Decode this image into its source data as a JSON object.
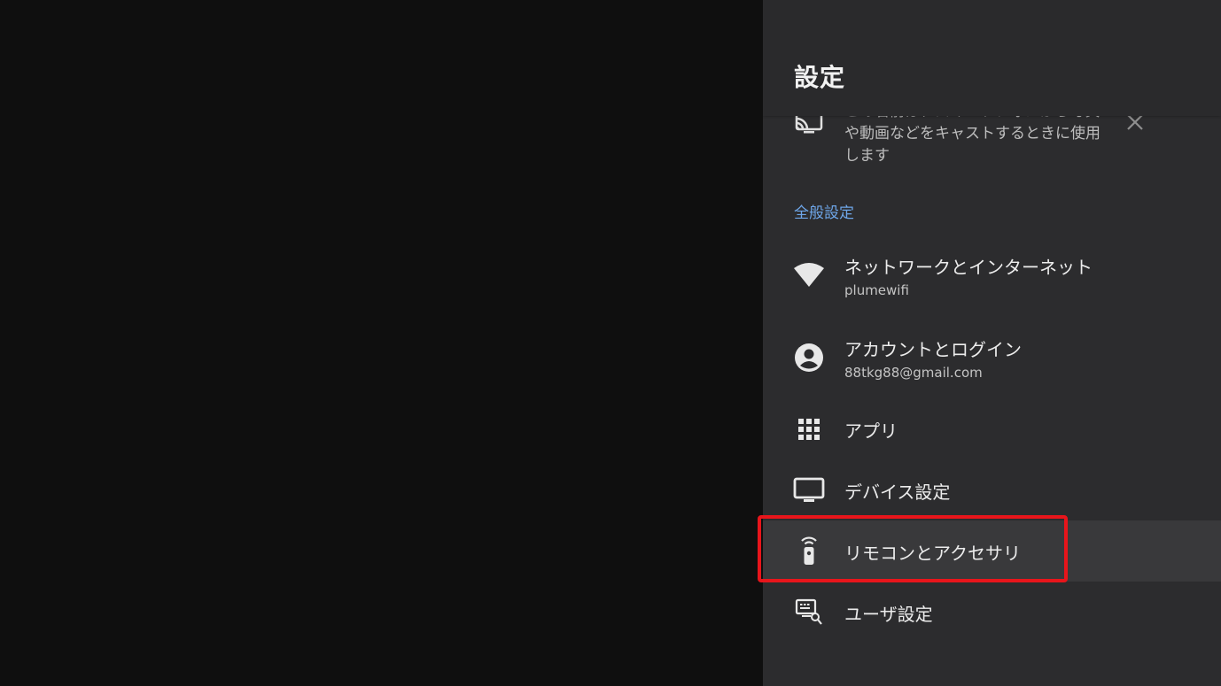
{
  "header": {
    "title": "設定"
  },
  "cast_card": {
    "text_line1": "この名前は、スマートフォンから写真",
    "text_line2": "や動画などをキャストするときに使用",
    "text_line3": "します",
    "icon": "cast-icon",
    "close_icon": "close-icon"
  },
  "section": {
    "label": "全般設定"
  },
  "items": [
    {
      "title": "ネットワークとインターネット",
      "subtitle": "plumewifi",
      "icon": "wifi-icon"
    },
    {
      "title": "アカウントとログイン",
      "subtitle": "88tkg88@gmail.com",
      "icon": "account-circle-icon"
    },
    {
      "title": "アプリ",
      "icon": "apps-grid-icon"
    },
    {
      "title": "デバイス設定",
      "icon": "tv-icon"
    },
    {
      "title": "リモコンとアクセサリ",
      "icon": "remote-icon",
      "focused": true
    },
    {
      "title": "ユーザ設定",
      "icon": "user-settings-icon"
    }
  ],
  "colors": {
    "panel_bg": "#2c2c2e",
    "accent": "#6ea6e8",
    "highlight": "#e8151b"
  }
}
